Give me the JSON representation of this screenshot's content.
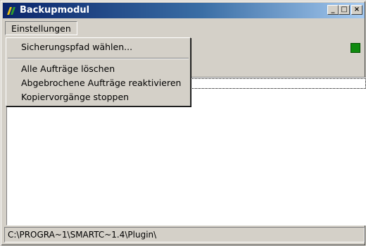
{
  "window": {
    "title": "Backupmodul",
    "icon": "backup-app-icon",
    "controls": {
      "minimize": "_",
      "maximize": "□",
      "close": "×"
    }
  },
  "menubar": {
    "settings_label": "Einstellungen"
  },
  "menu": {
    "choose_backup_path": "Sicherungspfad wählen...",
    "delete_all_jobs": "Alle Aufträge löschen",
    "reactivate_aborted": "Abgebrochene Aufträge reaktivieren",
    "stop_copy": "Kopiervorgänge stoppen"
  },
  "status_indicator": {
    "color": "#0f8a0f"
  },
  "statusbar": {
    "path": "C:\\PROGRA~1\\SMARTC~1.4\\Plugin\\"
  }
}
